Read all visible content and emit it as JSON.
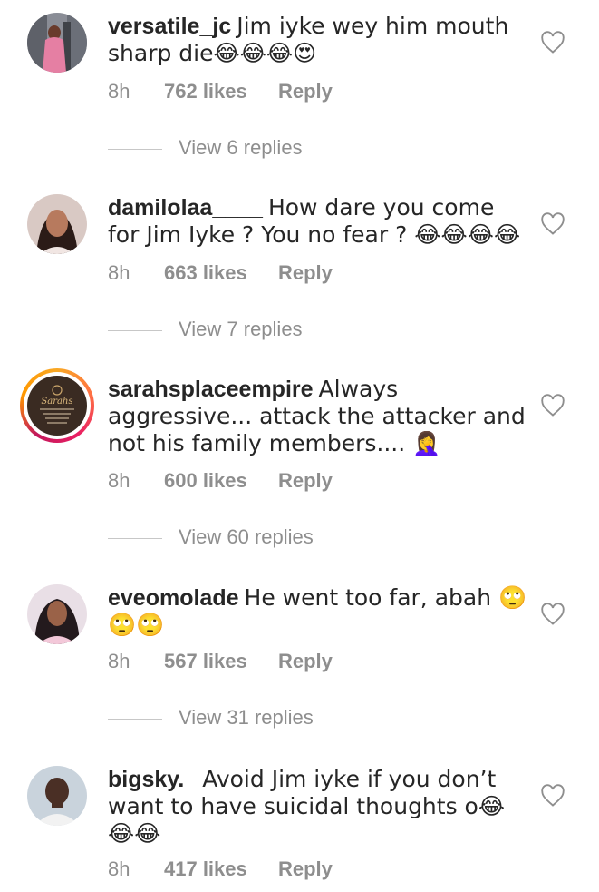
{
  "comments": [
    {
      "username": "versatile_jc",
      "text": "Jim iyke wey him mouth sharp die😂😂😂😍",
      "time": "8h",
      "likes": "762 likes",
      "reply": "Reply",
      "view_replies": "View 6 replies"
    },
    {
      "username": "damilolaa____",
      "text": "How dare you come for Jim Iyke ? You no fear ? 😂😂😂😂",
      "time": "8h",
      "likes": "663 likes",
      "reply": "Reply",
      "view_replies": "View 7 replies"
    },
    {
      "username": "sarahsplaceempire",
      "text": "Always aggressive... attack the attacker and not his family members.... 🤦‍♀️",
      "time": "8h",
      "likes": "600 likes",
      "reply": "Reply",
      "view_replies": "View 60 replies",
      "avatar_text": "Sarahs"
    },
    {
      "username": "eveomolade",
      "text": "He went too far, abah 🙄🙄🙄",
      "time": "8h",
      "likes": "567 likes",
      "reply": "Reply",
      "view_replies": "View 31 replies"
    },
    {
      "username": "bigsky._",
      "text": "Avoid Jim iyke if you don’t want to have suicidal thoughts o😂😂😂",
      "time": "8h",
      "likes": "417 likes",
      "reply": "Reply"
    }
  ],
  "colors": {
    "text": "#262626",
    "muted": "#8e8e8e",
    "divider": "#c7c7c7"
  },
  "icons": {
    "like": "heart-outline-icon"
  }
}
